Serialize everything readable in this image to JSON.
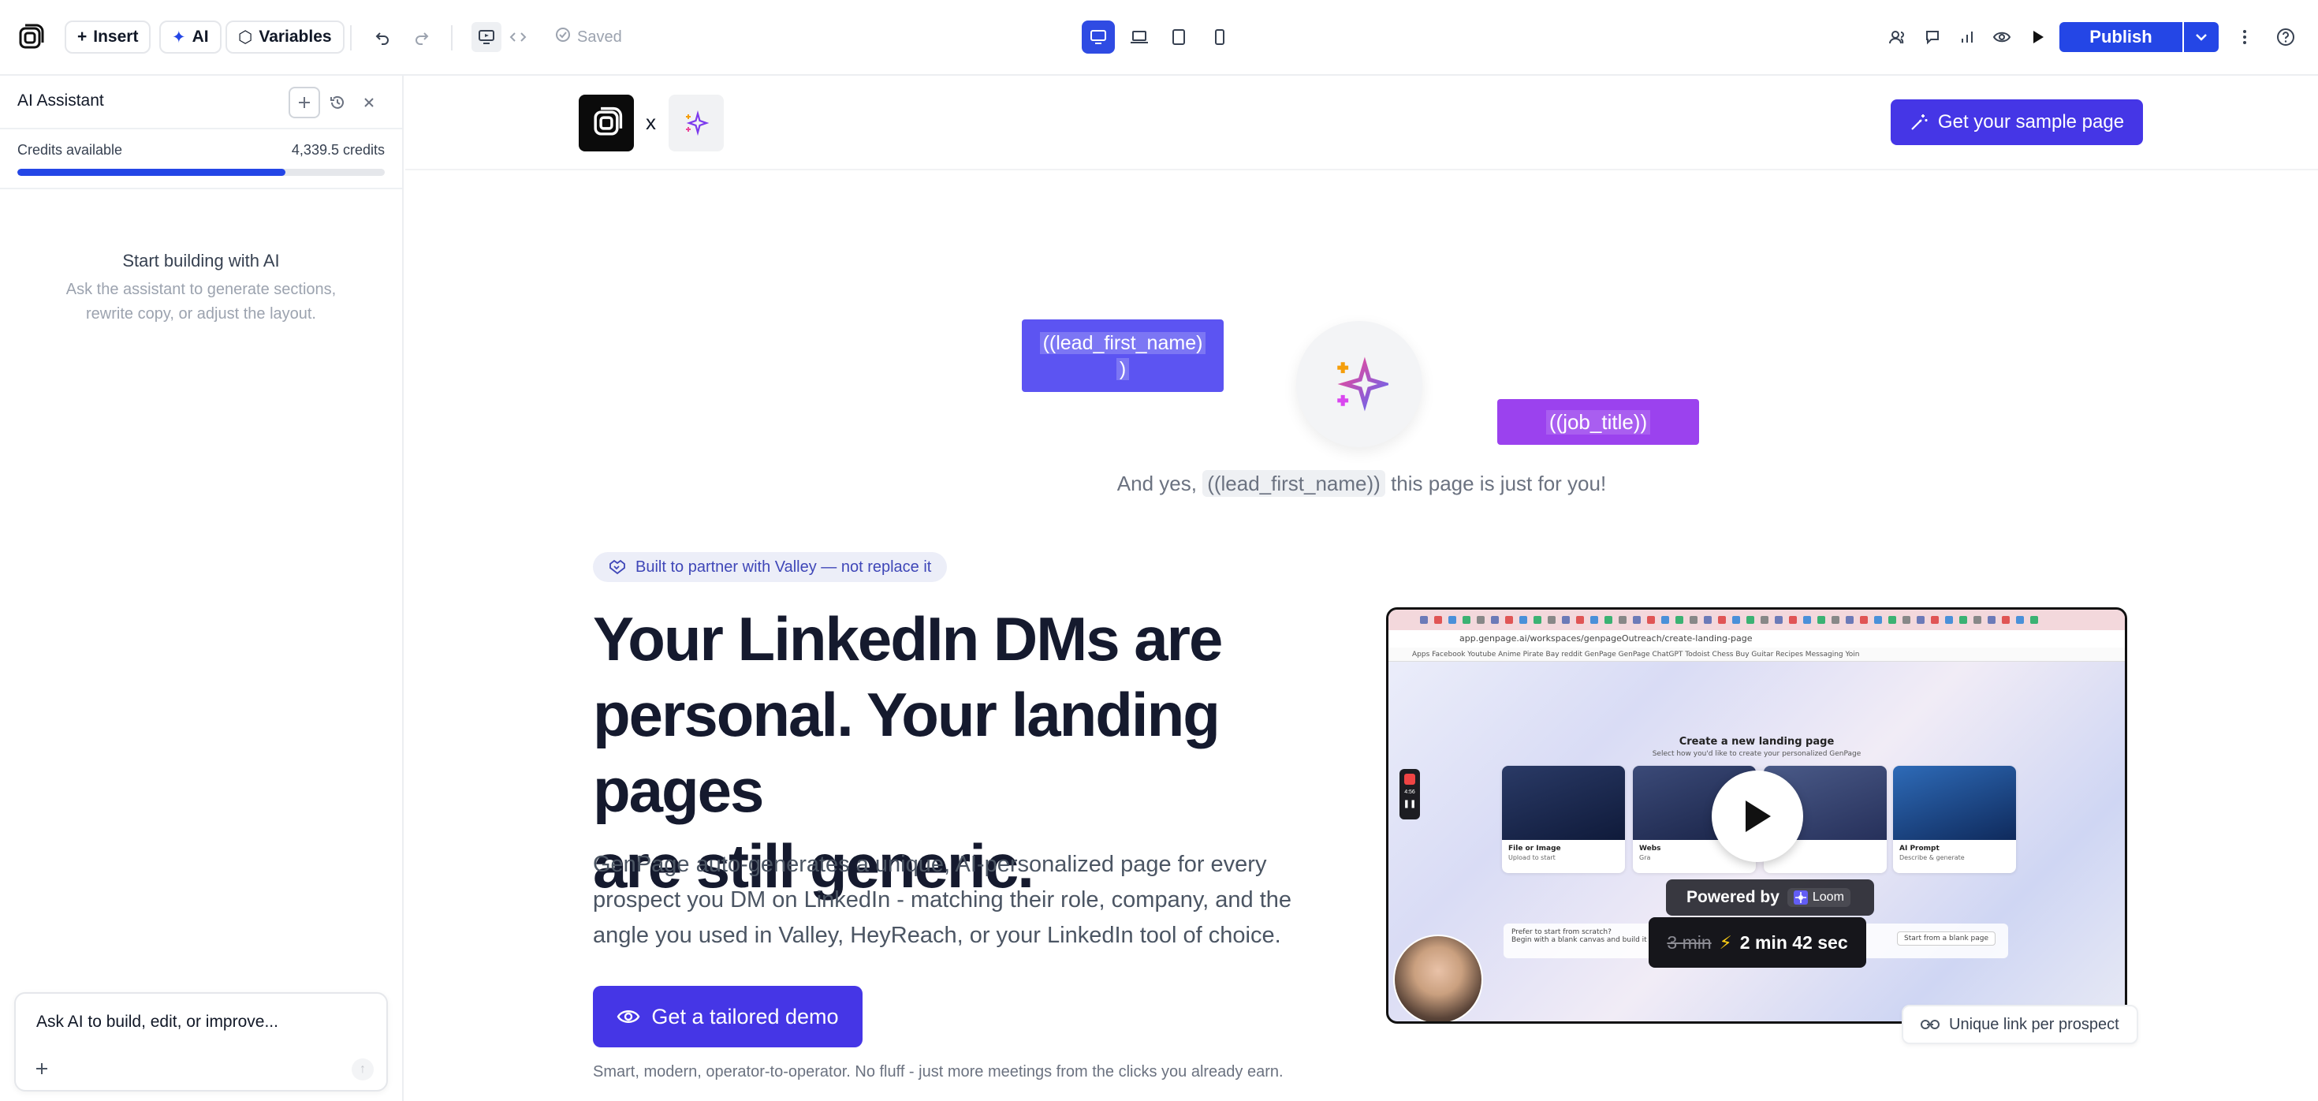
{
  "toolbar": {
    "insert_label": "Insert",
    "ai_label": "AI",
    "variables_label": "Variables",
    "saved_label": "Saved",
    "publish_label": "Publish"
  },
  "sidebar": {
    "title": "AI Assistant",
    "credits_label": "Credits available",
    "credits_value": "4,339.5 credits",
    "credits_fraction": 0.73,
    "empty_title": "Start building with AI",
    "empty_subtitle": "Ask the assistant to generate sections, rewrite copy, or adjust the layout.",
    "chat_placeholder": "Ask AI to build, edit, or improve..."
  },
  "page": {
    "brand_x": "x",
    "top_cta": "Get your sample page",
    "pill_first_name": "((lead_first_name)",
    "pill_first_name_tail": ")",
    "pill_job_title": "((job_title))",
    "yes_prefix": "And yes,",
    "yes_chip": "((lead_first_name))",
    "yes_suffix": "this page is just for you!",
    "badge": "Built to partner with Valley — not replace it",
    "hero_line1": "Your LinkedIn DMs are",
    "hero_line2": "personal. Your landing pages",
    "hero_line3": "are still generic.",
    "hero_sub": "GenPage auto-generates a unique, AI-personalized page for every prospect you DM on LinkedIn - matching their role, company, and the angle you used in Valley, HeyReach, or your LinkedIn tool of choice.",
    "demo_cta": "Get a tailored demo",
    "footnote": "Smart, modern, operator-to-operator. No fluff - just more meetings from the clicks you already earn.",
    "unique_link": "Unique link per prospect"
  },
  "video": {
    "url": "app.genpage.ai/workspaces/genpageOutreach/create-landing-page",
    "bookmarks": "Apps  Facebook  Youtube  Anime  Pirate Bay  reddit  GenPage  GenPage  ChatGPT  Todoist  Chess  Buy  Guitar  Recipes  Messaging  Yoin",
    "heading": "Create a new landing page",
    "subheading": "Select how you'd like to create your personalized GenPage",
    "card1_title": "File or Image",
    "card1_sub": "Upload to start",
    "card2_title": "Webs",
    "card2_sub": "Gra",
    "card4_title": "AI Prompt",
    "card4_sub": "Describe & generate",
    "bottom_q": "Prefer to start from scratch?",
    "bottom_sub": "Begin with a blank canvas and build it your way",
    "bottom_btn": "Start from a blank page",
    "powered_by": "Powered by",
    "loom": "Loom",
    "time_old": "3 min",
    "time_new": "2 min 42 sec",
    "rec_time": "4:56"
  },
  "colors": {
    "primary": "#2446e6",
    "cta": "#4536e6",
    "pill_blue": "#5c54f2",
    "pill_purple": "#9b42ee"
  }
}
